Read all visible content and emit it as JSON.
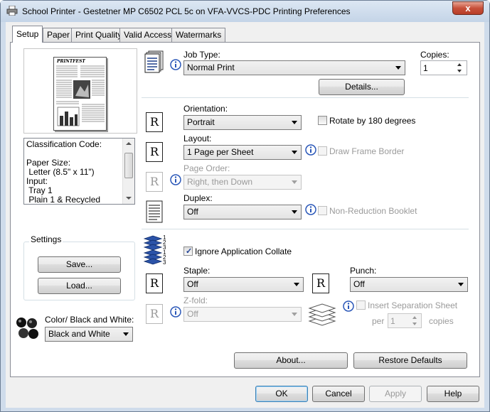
{
  "window": {
    "title": "School Printer - Gestetner MP C6502 PCL 5c on VFA-VVCS-PDC Printing Preferences",
    "close_label": "x"
  },
  "tabs": [
    {
      "label": "Setup"
    },
    {
      "label": "Paper"
    },
    {
      "label": "Print Quality"
    },
    {
      "label": "Valid Access"
    },
    {
      "label": "Watermarks"
    }
  ],
  "preview": {
    "masthead": "PRINTFEST"
  },
  "classification": {
    "lines": [
      "Classification Code:",
      "",
      "Paper Size:",
      " Letter (8.5\" x 11\")",
      "Input:",
      " Tray 1",
      " Plain 1 & Recycled"
    ]
  },
  "settings": {
    "group_label": "Settings",
    "save_label": "Save...",
    "load_label": "Load..."
  },
  "color": {
    "label": "Color/ Black and White:",
    "value": "Black and White"
  },
  "job": {
    "label": "Job Type:",
    "value": "Normal Print",
    "copies_label": "Copies:",
    "copies_value": "1",
    "details_label": "Details..."
  },
  "orientation": {
    "label": "Orientation:",
    "value": "Portrait",
    "rotate_label": "Rotate by 180 degrees",
    "icon_letter": "R"
  },
  "layout": {
    "label": "Layout:",
    "value": "1 Page per Sheet",
    "frame_label": "Draw Frame Border"
  },
  "page_order": {
    "label": "Page Order:",
    "value": "Right, then Down"
  },
  "duplex": {
    "label": "Duplex:",
    "value": "Off",
    "booklet_label": "Non-Reduction Booklet"
  },
  "collate": {
    "label": "Ignore Application Collate",
    "checked": true,
    "stack_numbers": [
      "1",
      "2",
      "3",
      "1",
      "2",
      "3"
    ]
  },
  "staple": {
    "label": "Staple:",
    "value": "Off"
  },
  "punch": {
    "label": "Punch:",
    "value": "Off"
  },
  "zfold": {
    "label": "Z-fold:",
    "value": "Off"
  },
  "separation": {
    "label": "Insert Separation Sheet",
    "per_label": "per",
    "per_value": "1",
    "copies_label": "copies"
  },
  "panel_buttons": {
    "about_label": "About...",
    "restore_label": "Restore Defaults"
  },
  "dialog_buttons": {
    "ok_label": "OK",
    "cancel_label": "Cancel",
    "apply_label": "Apply",
    "help_label": "Help"
  }
}
